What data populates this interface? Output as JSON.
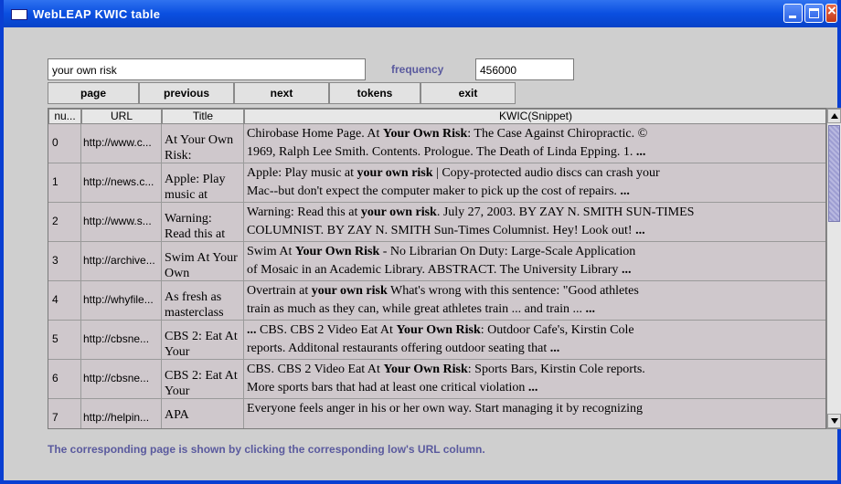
{
  "window": {
    "title": "WebLEAP KWIC table"
  },
  "query": {
    "value": "your own risk"
  },
  "frequency": {
    "label": "frequency",
    "value": "456000"
  },
  "toolbar": [
    {
      "label": "page"
    },
    {
      "label": "previous"
    },
    {
      "label": "next"
    },
    {
      "label": "tokens"
    },
    {
      "label": "exit"
    }
  ],
  "table": {
    "columns": [
      "nu...",
      "URL",
      "Title",
      "KWIC(Snippet)"
    ],
    "rows": [
      {
        "num": "0",
        "url": "http://www.c...",
        "title": "At Your Own Risk:",
        "kwic": "Chirobase Home Page. At <b>Your Own Risk</b>: The Case Against Chiropractic. ©<br>1969, Ralph Lee Smith. Contents. Prologue. The Death of Linda Epping. 1. <b>...</b>"
      },
      {
        "num": "1",
        "url": "http://news.c...",
        "title": "Apple: Play music at",
        "kwic": "Apple: Play music at <b>your own risk</b> | Copy-protected audio discs can crash your<br>Mac--but don't expect the computer maker to pick up the cost of repairs. <b>...</b>"
      },
      {
        "num": "2",
        "url": "http://www.s...",
        "title": "Warning: Read this at",
        "kwic": "Warning: Read this at <b>your own risk</b>. July 27, 2003. BY ZAY N. SMITH SUN-TIMES<br>COLUMNIST. BY ZAY N. SMITH Sun-Times Columnist. Hey! Look out! <b>...</b>"
      },
      {
        "num": "3",
        "url": "http://archive...",
        "title": "Swim At Your Own",
        "kwic": "Swim At <b>Your Own Risk</b> - No Librarian On Duty: Large-Scale Application<br>of Mosaic in an Academic Library. ABSTRACT. The University Library <b>...</b>"
      },
      {
        "num": "4",
        "url": "http://whyfile...",
        "title": "As fresh as masterclass",
        "kwic": "Overtrain at <b>your own risk</b> What's wrong with this sentence: \"Good athletes<br>train as much as they can, while great athletes train ... and train ... <b>...</b>"
      },
      {
        "num": "5",
        "url": "http://cbsne...",
        "title": "CBS 2: Eat At Your",
        "kwic": "<b>...</b> CBS. CBS 2 Video Eat At <b>Your Own Risk</b>: Outdoor Cafe's, Kirstin Cole<br>reports. Additonal restaurants offering outdoor seating that <b>...</b>"
      },
      {
        "num": "6",
        "url": "http://cbsne...",
        "title": "CBS 2: Eat At Your",
        "kwic": "CBS. CBS 2 Video Eat At <b>Your Own Risk</b>: Sports Bars, Kirstin Cole reports.<br>More sports bars that had at least one critical violation <b>...</b>"
      },
      {
        "num": "7",
        "url": "http://helpin...",
        "title": "APA",
        "kwic": "Everyone feels anger in his or her own way. Start managing it by recognizing"
      }
    ]
  },
  "footer": {
    "note": "The corresponding page is shown by clicking the corresponding low's URL column."
  }
}
